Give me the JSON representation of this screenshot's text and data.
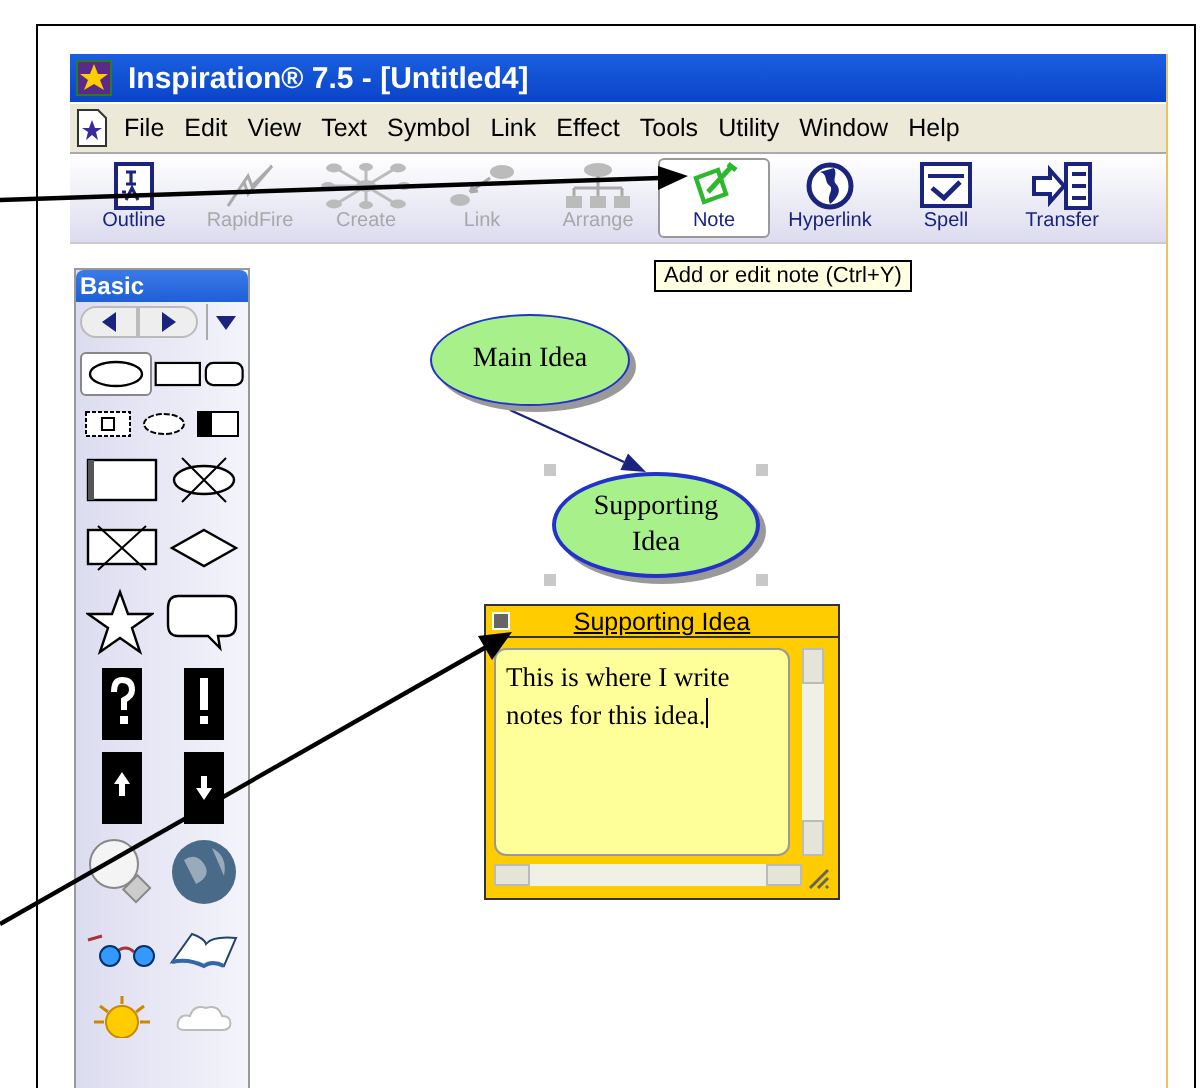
{
  "window": {
    "title": "Inspiration® 7.5 - [Untitled4]"
  },
  "menu": [
    "File",
    "Edit",
    "View",
    "Text",
    "Symbol",
    "Link",
    "Effect",
    "Tools",
    "Utility",
    "Window",
    "Help"
  ],
  "toolbar": [
    {
      "label": "Outline",
      "kind": "outline",
      "disabled": false,
      "selected": false
    },
    {
      "label": "RapidFire",
      "kind": "rapidfire",
      "disabled": true,
      "selected": false
    },
    {
      "label": "Create",
      "kind": "create",
      "disabled": true,
      "selected": false
    },
    {
      "label": "Link",
      "kind": "link",
      "disabled": true,
      "selected": false
    },
    {
      "label": "Arrange",
      "kind": "arrange",
      "disabled": true,
      "selected": false
    },
    {
      "label": "Note",
      "kind": "note",
      "disabled": false,
      "selected": true
    },
    {
      "label": "Hyperlink",
      "kind": "hyperlink",
      "disabled": false,
      "selected": false
    },
    {
      "label": "Spell",
      "kind": "spell",
      "disabled": false,
      "selected": false
    },
    {
      "label": "Transfer",
      "kind": "transfer",
      "disabled": false,
      "selected": false
    }
  ],
  "tooltip": "Add or edit note (Ctrl+Y)",
  "palette": {
    "title": "Basic"
  },
  "diagram": {
    "nodes": [
      {
        "label": "Main Idea",
        "selected": false
      },
      {
        "label": "Supporting Idea",
        "selected": true
      }
    ]
  },
  "note": {
    "title": "Supporting Idea",
    "text": "This is where I write notes for this idea."
  }
}
